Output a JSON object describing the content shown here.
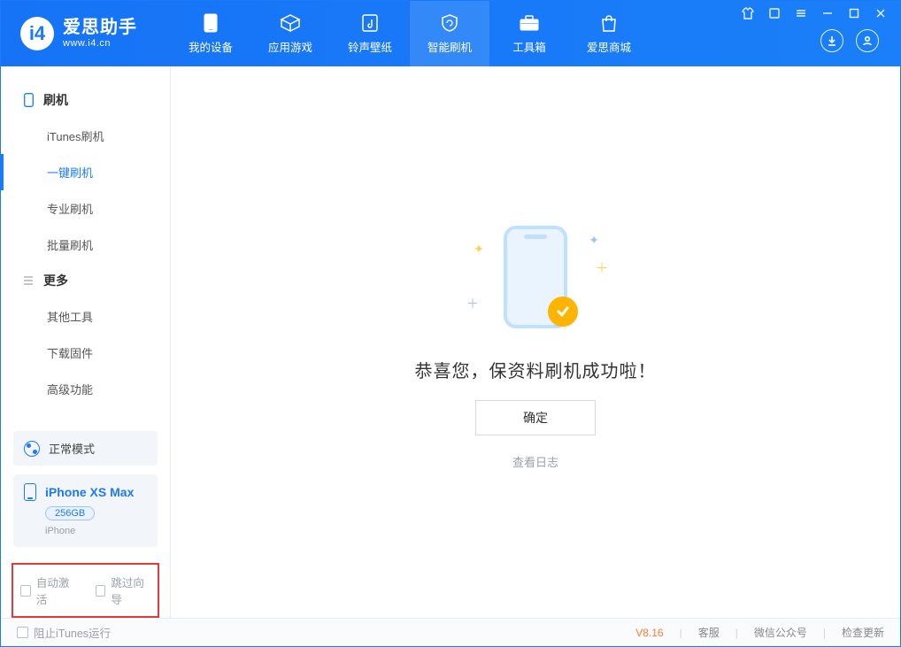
{
  "app": {
    "name_cn": "爱思助手",
    "url": "www.i4.cn"
  },
  "nav": {
    "items": [
      {
        "label": "我的设备"
      },
      {
        "label": "应用游戏"
      },
      {
        "label": "铃声壁纸"
      },
      {
        "label": "智能刷机"
      },
      {
        "label": "工具箱"
      },
      {
        "label": "爱思商城"
      }
    ]
  },
  "sidebar": {
    "group1": {
      "title": "刷机",
      "items": [
        "iTunes刷机",
        "一键刷机",
        "专业刷机",
        "批量刷机"
      ],
      "active_index": 1
    },
    "group2": {
      "title": "更多",
      "items": [
        "其他工具",
        "下载固件",
        "高级功能"
      ]
    },
    "status_mode": "正常模式",
    "device": {
      "name": "iPhone XS Max",
      "storage": "256GB",
      "type": "iPhone"
    },
    "options": {
      "auto_activate": "自动激活",
      "skip_guide": "跳过向导"
    }
  },
  "main": {
    "success_text": "恭喜您，保资料刷机成功啦！",
    "confirm_label": "确定",
    "log_link": "查看日志"
  },
  "footer": {
    "block_itunes": "阻止iTunes运行",
    "version": "V8.16",
    "links": [
      "客服",
      "微信公众号",
      "检查更新"
    ]
  }
}
